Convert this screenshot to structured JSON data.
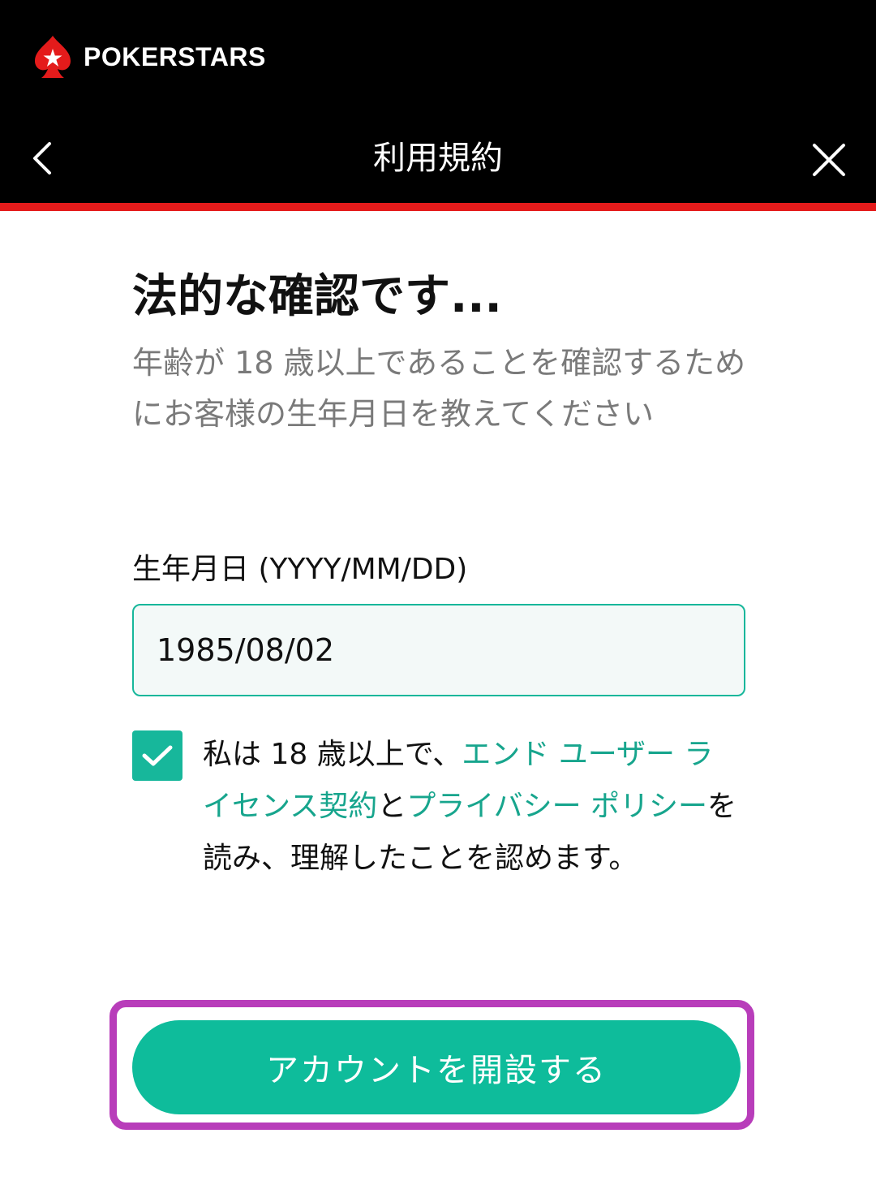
{
  "brand": {
    "name": "POKERSTARS",
    "logo_icon": "spade-star-icon"
  },
  "nav": {
    "title": "利用規約",
    "back_icon": "chevron-left-icon",
    "close_icon": "close-icon"
  },
  "content": {
    "heading": "法的な確認です...",
    "subtext": "年齢が 18 歳以上であることを確認するためにお客様の生年月日を教えてください",
    "dob_label": "生年月日 (YYYY/MM/DD)",
    "dob_value": "1985/08/02"
  },
  "consent": {
    "checked": true,
    "text_prefix": "私は 18 歳以上で、",
    "eula_link": "エンド ユーザー ライセンス契約",
    "text_and": "と",
    "privacy_link": "プライバシー ポリシー",
    "text_suffix": "を読み、理解したことを認めます。"
  },
  "actions": {
    "open_account_label": "アカウントを開設する"
  },
  "colors": {
    "header_bg": "#000000",
    "accent_red": "#e41b1b",
    "brand_teal": "#0ebc9b",
    "link_teal": "#17a58d",
    "highlight_purple": "#b83dba"
  }
}
